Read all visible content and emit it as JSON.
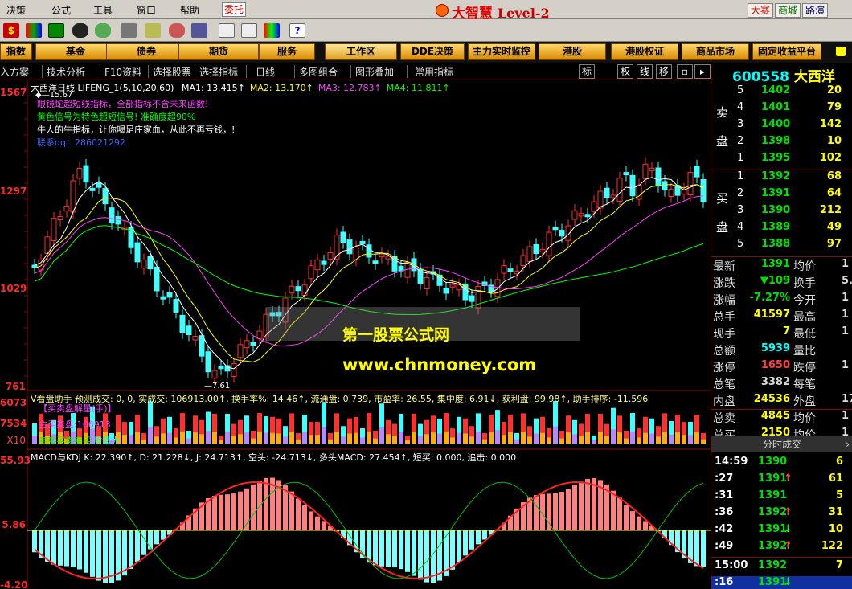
{
  "menubar": {
    "items": [
      "决策",
      "公式",
      "工具",
      "窗口",
      "帮助"
    ],
    "weituo": "委托",
    "brand": "大智慧",
    "level": "Level-2",
    "right_buttons": [
      "大赛",
      "商城",
      "路演"
    ]
  },
  "categories": [
    "指数",
    "基金",
    "债券",
    "期货",
    "服务",
    "工作区",
    "DDE决策",
    "主力实时监控",
    "港股",
    "港股权证",
    "商品市场",
    "固定收益平台"
  ],
  "tabs": {
    "items": [
      "入方案",
      "技术分析",
      "F10资料",
      "选择股票",
      "选择指标",
      "日线",
      "多图组合",
      "图形叠加",
      "常用指标"
    ],
    "box_labels": [
      "标",
      "权",
      "线",
      "移"
    ]
  },
  "chart": {
    "title_stock": "大西洋",
    "title_period": "日线",
    "indicator_name": "LIFENG_1",
    "params": "(5,10,20,60)",
    "ma": [
      {
        "label": "MA1:",
        "value": "13.415",
        "color": "#ffffff"
      },
      {
        "label": "MA2:",
        "value": "13.170",
        "color": "#ffff00"
      },
      {
        "label": "MA3:",
        "value": "12.783",
        "color": "#ff40ff"
      },
      {
        "label": "MA4:",
        "value": "11.811",
        "color": "#00ff00"
      }
    ],
    "notes": [
      {
        "text": "眼镜蛇超短线指标，全部指标不含未来函数!",
        "color": "#ff40ff"
      },
      {
        "text": "黄色信号为特色超短信号! 准确度超90%",
        "color": "#00ff00"
      },
      {
        "text": "牛人的牛指标，让你喝足庄家血，从此不再亏钱，!",
        "color": "#ffffff"
      },
      {
        "text": "联系qq：286021292",
        "color": "#4060ff"
      }
    ],
    "high_marker": "15.67",
    "low_marker": "7.61",
    "watermark1": "第一股票公式网",
    "watermark2": "www.chnmoney.com",
    "price_axis": [
      "1567",
      "1297",
      "1029",
      "761"
    ],
    "vol_axis": [
      "6073",
      "7534",
      "X10"
    ],
    "macd_axis": [
      "55.93",
      "5.86",
      "-4.20"
    ]
  },
  "volume_panel": {
    "header": "V看盘助手 预测成交: 0, 0, 实成交: 106913.00↑, 换手率%: 14.46↑, 流通盘: 0.739, 市盈率: 26.55, 集中度: 6.91↓, 获利盘: 99.98↑, 助手排序: -11.596",
    "label1": "【买卖盘解量(手)】",
    "label2": "主买卖盘:106913",
    "label3": "卖卖买卖卖买",
    "label4": "放量大"
  },
  "macd_panel": {
    "header": "MACD与KDJ K: 22.390↑, D: 21.228↓, J: 24.713↑, 空头: -24.713↓, 多头MACD: 27.454↑, 短买: 0.000, 追击: 0.000"
  },
  "quote": {
    "code": "600558",
    "name": "大西洋",
    "sell_label": [
      "卖",
      "盘"
    ],
    "buy_label": [
      "买",
      "盘"
    ],
    "sells": [
      {
        "n": "5",
        "price": "1402",
        "vol": "20"
      },
      {
        "n": "4",
        "price": "1401",
        "vol": "79"
      },
      {
        "n": "3",
        "price": "1400",
        "vol": "142"
      },
      {
        "n": "2",
        "price": "1398",
        "vol": "10"
      },
      {
        "n": "1",
        "price": "1395",
        "vol": "102"
      }
    ],
    "buys": [
      {
        "n": "1",
        "price": "1392",
        "vol": "68"
      },
      {
        "n": "2",
        "price": "1391",
        "vol": "64"
      },
      {
        "n": "3",
        "price": "1390",
        "vol": "212"
      },
      {
        "n": "4",
        "price": "1389",
        "vol": "49"
      },
      {
        "n": "5",
        "price": "1388",
        "vol": "97"
      }
    ],
    "stats": [
      {
        "k1": "最新",
        "v1": "1391",
        "k2": "均价",
        "v2": "1"
      },
      {
        "k1": "涨跌",
        "v1": "▼109",
        "k2": "换手",
        "v2": "5."
      },
      {
        "k1": "涨幅",
        "v1": "-7.27%",
        "k2": "今开",
        "v2": "1"
      },
      {
        "k1": "总手",
        "v1": "41597",
        "k2": "最高",
        "v2": "1"
      },
      {
        "k1": "现手",
        "v1": "7",
        "k2": "最低",
        "v2": "1"
      },
      {
        "k1": "总额",
        "v1": "5939",
        "k2": "量比",
        "v2": ""
      },
      {
        "k1": "涨停",
        "v1": "1650",
        "k2": "跌停",
        "v2": "1"
      },
      {
        "k1": "总笔",
        "v1": "3382",
        "k2": "每笔",
        "v2": ""
      },
      {
        "k1": "内盘",
        "v1": "24536",
        "k2": "外盘",
        "v2": "17"
      },
      {
        "k1": "总卖",
        "v1": "4845",
        "k2": "均价",
        "v2": "1"
      },
      {
        "k1": "总买",
        "v1": "2150",
        "k2": "均价",
        "v2": "1"
      }
    ],
    "ticks_title": "分时成交",
    "ticks": [
      {
        "t": "14:59",
        "p": "1390",
        "v": "6",
        "arrow": ""
      },
      {
        "t": ":27",
        "p": "1391",
        "v": "61",
        "arrow": "↑"
      },
      {
        "t": ":31",
        "p": "1391",
        "v": "5",
        "arrow": ""
      },
      {
        "t": ":36",
        "p": "1392",
        "v": "31",
        "arrow": "↑"
      },
      {
        "t": ":42",
        "p": "1391",
        "v": "10",
        "arrow": "↓"
      },
      {
        "t": ":49",
        "p": "1392",
        "v": "122",
        "arrow": "↑"
      },
      {
        "t": "15:00",
        "p": "1392",
        "v": "7",
        "arrow": ""
      },
      {
        "t": ":16",
        "p": "1391",
        "v": "",
        "arrow": "↓"
      }
    ]
  }
}
